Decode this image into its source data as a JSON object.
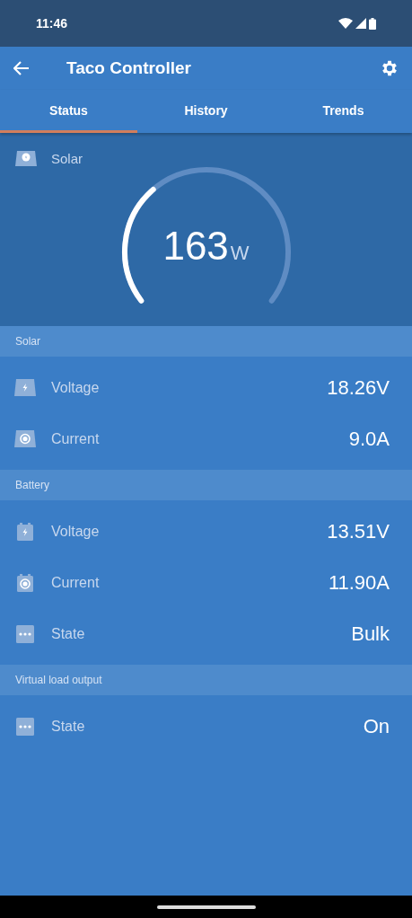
{
  "status_bar": {
    "time": "11:46"
  },
  "app_bar": {
    "title": "Taco Controller"
  },
  "tabs": [
    {
      "label": "Status",
      "selected": true
    },
    {
      "label": "History",
      "selected": false
    },
    {
      "label": "Trends",
      "selected": false
    }
  ],
  "gauge": {
    "label": "Solar",
    "value": "163",
    "unit": "W"
  },
  "sections": [
    {
      "title": "Solar",
      "rows": [
        {
          "kind": "panel-bolt",
          "label": "Voltage",
          "value": "18.26V"
        },
        {
          "kind": "panel-dot",
          "label": "Current",
          "value": "9.0A"
        }
      ]
    },
    {
      "title": "Battery",
      "rows": [
        {
          "kind": "battery-bolt",
          "label": "Voltage",
          "value": "13.51V"
        },
        {
          "kind": "battery-dot",
          "label": "Current",
          "value": "11.90A"
        },
        {
          "kind": "dots",
          "label": "State",
          "value": "Bulk"
        }
      ]
    },
    {
      "title": "Virtual load output",
      "rows": [
        {
          "kind": "dots",
          "label": "State",
          "value": "On"
        }
      ]
    }
  ]
}
